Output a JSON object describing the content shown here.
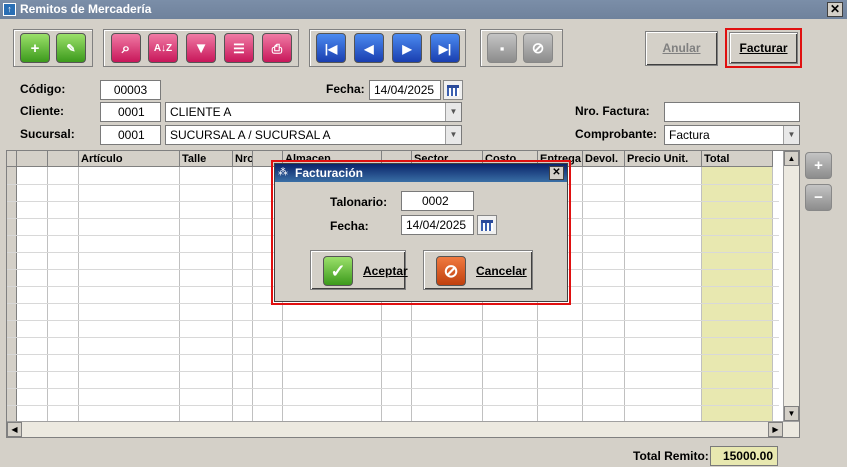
{
  "window": {
    "title": "Remitos de Mercadería",
    "close": "✕"
  },
  "toolbar": {
    "anular": "Anular",
    "facturar": "Facturar",
    "sort_label": "A↓Z"
  },
  "form": {
    "codigo_label": "Código:",
    "codigo": "00003",
    "fecha_label": "Fecha:",
    "fecha": "14/04/2025",
    "cliente_label": "Cliente:",
    "cliente_code": "0001",
    "cliente_name": "CLIENTE A",
    "sucursal_label": "Sucursal:",
    "sucursal_code": "0001",
    "sucursal_name": "SUCURSAL A / SUCURSAL A",
    "nro_factura_label": "Nro. Factura:",
    "nro_factura": "",
    "comprobante_label": "Comprobante:",
    "comprobante": "Factura"
  },
  "grid": {
    "columns": [
      "Artículo",
      "Talle",
      "Nro",
      "Almacen",
      "Sector",
      "Costo",
      "Entrega",
      "Devol.",
      "Precio Unit.",
      "Total"
    ]
  },
  "totals": {
    "label": "Total Remito:",
    "value": "15000.00"
  },
  "dialog": {
    "title": "Facturación",
    "close": "✕",
    "talonario_label": "Talonario:",
    "talonario": "0002",
    "fecha_label": "Fecha:",
    "fecha": "14/04/2025",
    "accept": "Aceptar",
    "cancel": "Cancelar"
  },
  "colors": {
    "highlight": "#e01010",
    "total_column": "#e8e8b0"
  }
}
